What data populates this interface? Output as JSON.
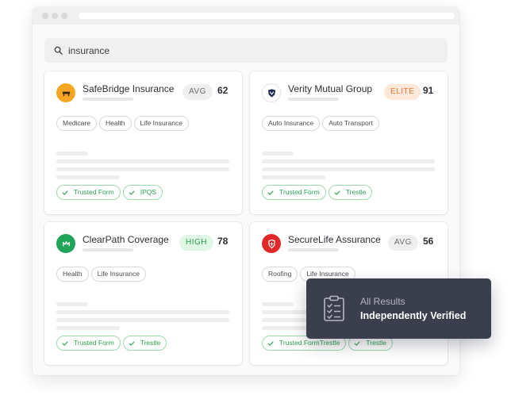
{
  "search": {
    "query": "insurance",
    "icon": "search-icon"
  },
  "colors": {
    "accent_green": "#2ea152",
    "elite_orange": "#e9773a",
    "toast_bg": "#3a3e4d"
  },
  "cards": [
    {
      "name": "SafeBridge Insurance",
      "tier": "AVG",
      "score": "62",
      "logo_icon": "safebridge-logo-icon",
      "logo_color": "#f5a623",
      "tags": [
        "Medicare",
        "Health",
        "Life Insurance"
      ],
      "badges": [
        "Trusted Form",
        "IPQS"
      ]
    },
    {
      "name": "Verity Mutual Group",
      "tier": "ELITE",
      "score": "91",
      "logo_icon": "verity-shield-logo-icon",
      "logo_color": "#1f2a4d",
      "tags": [
        "Auto Insurance",
        "Auto Transport"
      ],
      "badges": [
        "Trusted Form",
        "Trestle"
      ]
    },
    {
      "name": "ClearPath Coverage",
      "tier": "HIGH",
      "score": "78",
      "logo_icon": "clearpath-logo-icon",
      "logo_color": "#1fa45a",
      "tags": [
        "Health",
        "Life Insurance"
      ],
      "badges": [
        "Trusted Form",
        "Trestle"
      ]
    },
    {
      "name": "SecureLife Assurance",
      "tier": "AVG",
      "score": "56",
      "logo_icon": "securelife-shield-logo-icon",
      "logo_color": "#e02828",
      "tags": [
        "Roofing",
        "Life Insurance"
      ],
      "badges": [
        "Trusted FormTrestle",
        "Trestle"
      ]
    }
  ],
  "toast": {
    "line1": "All Results",
    "line2": "Independently Verified",
    "icon": "checklist-icon"
  }
}
